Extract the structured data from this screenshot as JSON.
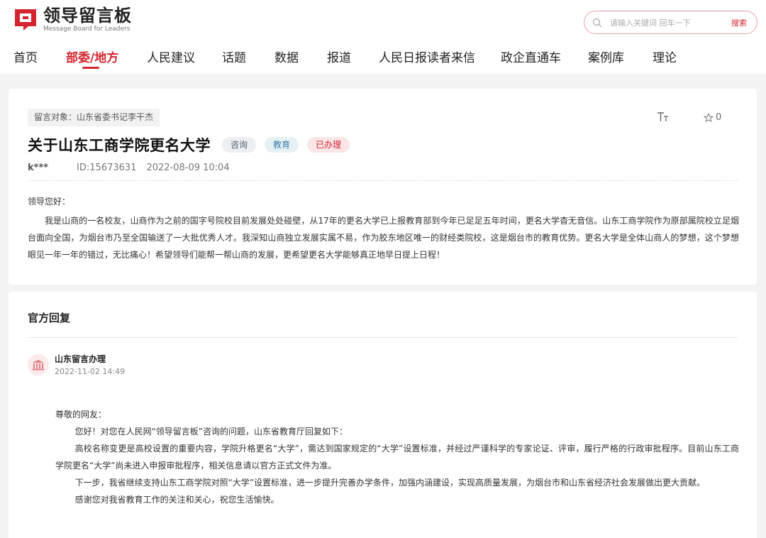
{
  "brand": {
    "name_cn": "领导留言板",
    "name_en": "Message Board for Leaders",
    "accent": "#d4252f"
  },
  "search": {
    "placeholder": "请输入关键词 回车一下",
    "button": "搜索"
  },
  "nav": {
    "items": [
      "首页",
      "部委/地方",
      "人民建议",
      "话题",
      "数据",
      "报道",
      "人民日报读者来信",
      "政企直通车",
      "案例库",
      "理论"
    ],
    "active_index": 1
  },
  "message": {
    "target": "留言对象：山东省委书记李干杰",
    "font_size_label": "T",
    "font_size_label_small": "T",
    "favorites": "0",
    "title": "关于山东工商学院更名大学",
    "tags": [
      "咨询",
      "教育",
      "已办理"
    ],
    "author": "k***",
    "id": "ID:15673631",
    "time": "2022-08-09 10:04",
    "greeting": "领导您好：",
    "body": "我是山商的一名校友，山商作为之前的国字号院校目前发展处处碰壁，从17年的更名大学已上报教育部到今年已足足五年时间，更名大学杳无音信。山东工商学院作为原部属院校立足烟台面向全国，为烟台市乃至全国输送了一大批优秀人才。我深知山商独立发展实属不易，作为胶东地区唯一的财经类院校，这是烟台市的教育优势。更名大学是全体山商人的梦想，这个梦想眼见一年一年的错过，无比痛心！希望领导们能帮一帮山商的发展，更希望更名大学能够真正地早日提上日程！"
  },
  "reply": {
    "heading": "官方回复",
    "org": "山东留言办理",
    "date": "2022-11-02 14:49",
    "salutation": "尊敬的网友：",
    "p1": "您好！对您在人民网“领导留言板”咨询的问题，山东省教育厅回复如下：",
    "p2": "高校名称变更是高校设置的重要内容，学院升格更名“大学”，需达到国家规定的“大学”设置标准，并经过严谨科学的专家论证、评审，履行严格的行政审批程序。目前山东工商学院更名“大学”尚未进入申报审批程序，相关信息请以官方正式文件为准。",
    "p3": "下一步，我省继续支持山东工商学院对照“大学”设置标准，进一步提升完善办学条件，加强内涵建设，实现高质量发展，为烟台市和山东省经济社会发展做出更大贡献。",
    "p4": "感谢您对我省教育工作的关注和关心，祝您生活愉快。"
  }
}
